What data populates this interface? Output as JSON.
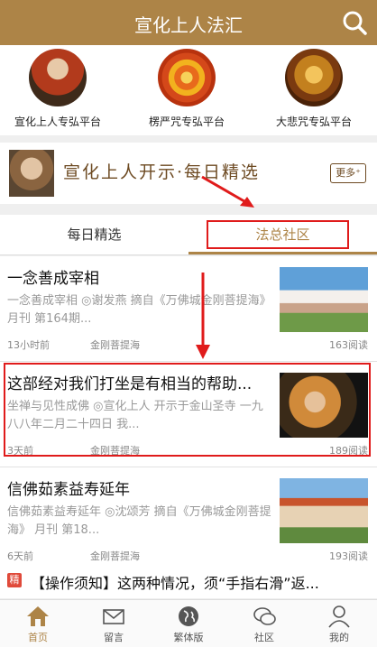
{
  "header": {
    "title": "宣化上人法汇"
  },
  "platforms": [
    {
      "label": "宣化上人专弘平台"
    },
    {
      "label": "楞严咒专弘平台"
    },
    {
      "label": "大悲咒专弘平台"
    }
  ],
  "banner": {
    "text": "宣化上人开示·每日精选",
    "more": "更多⁺"
  },
  "tabs": [
    {
      "label": "每日精选"
    },
    {
      "label": "法总社区"
    }
  ],
  "articles": [
    {
      "title": "一念善成宰相",
      "desc": "一念善成宰相 ◎谢发燕 摘自《万佛城金刚菩提海》 月刊 第164期...",
      "time": "13小时前",
      "source": "金刚菩提海",
      "reads": "163阅读"
    },
    {
      "title": "这部经对我们打坐是有相当的帮助...",
      "desc": "坐禅与见性成佛 ◎宣化上人 开示于金山圣寺 一九八八年二月二十四日 我...",
      "time": "3天前",
      "source": "金刚菩提海",
      "reads": "189阅读"
    },
    {
      "title": "信佛茹素益寿延年",
      "desc": "信佛茹素益寿延年 ◎沈颂芳 摘自《万佛城金刚菩提海》 月刊 第18...",
      "time": "6天前",
      "source": "金刚菩提海",
      "reads": "193阅读"
    }
  ],
  "notice": {
    "badge": "精",
    "text": "【操作须知】这两种情况，须“手指右滑”返..."
  },
  "nav": [
    {
      "label": "首页",
      "icon": "home-icon"
    },
    {
      "label": "留言",
      "icon": "mail-icon"
    },
    {
      "label": "繁体版",
      "icon": "globe-icon"
    },
    {
      "label": "社区",
      "icon": "chat-icon"
    },
    {
      "label": "我的",
      "icon": "user-icon"
    }
  ],
  "colors": {
    "brand": "#ad8447",
    "highlight": "#e01b1b"
  }
}
